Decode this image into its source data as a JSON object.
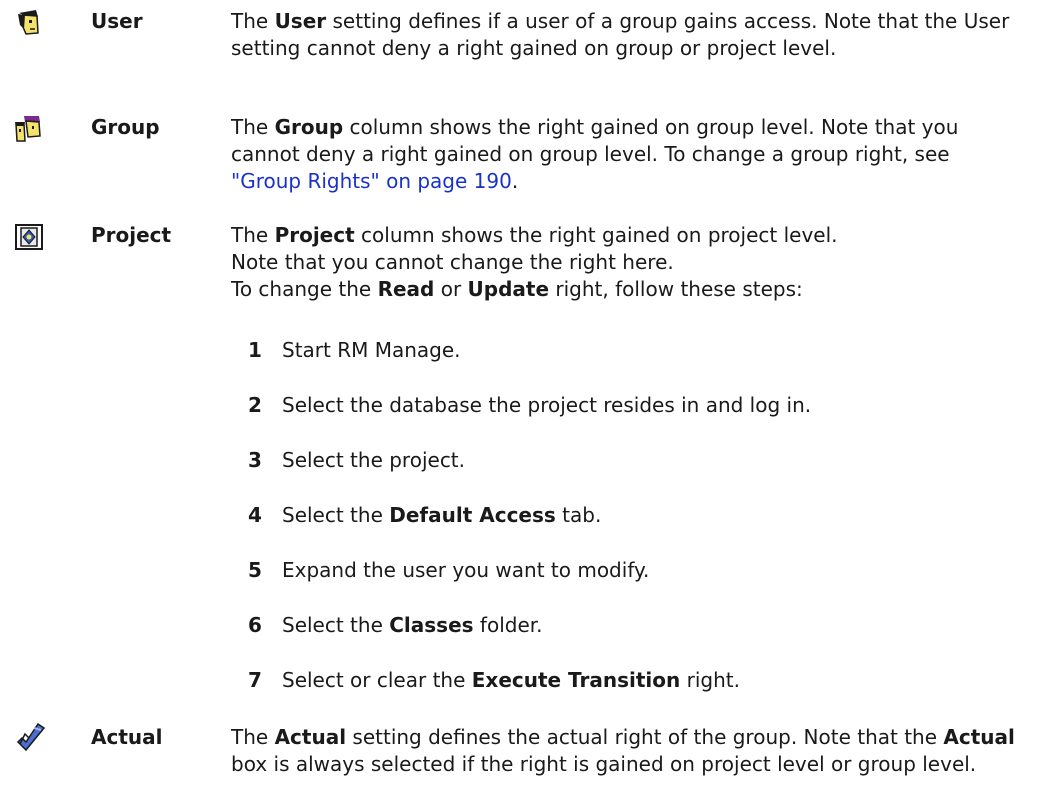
{
  "entries": [
    {
      "term": "User",
      "icon": "user-head-icon",
      "desc": {
        "pre": "The ",
        "bold": "User",
        "post": " setting defines if a user of a group gains access. Note that the User setting cannot deny a right gained on group or project level."
      }
    },
    {
      "term": "Group",
      "icon": "group-heads-icon",
      "desc": {
        "pre": "The ",
        "bold": "Group",
        "post": " column shows the right gained on group level. Note that you cannot deny a right gained on group level. To change a group right, see ",
        "link": "\"Group Rights\" on page 190",
        "end": "."
      }
    },
    {
      "term": "Project",
      "icon": "project-diamond-icon",
      "desc": {
        "pre": "The ",
        "bold": "Project",
        "post": " column shows the right gained on project level.",
        "line2": "Note that you cannot change the right here.",
        "line3_pre": "To change the ",
        "line3_b1": "Read",
        "line3_mid": " or ",
        "line3_b2": "Update",
        "line3_post": " right, follow these steps:"
      },
      "steps": [
        {
          "num": "1",
          "pre": "Start RM Manage.",
          "bold": "",
          "post": ""
        },
        {
          "num": "2",
          "pre": "Select the database the project resides in and log in.",
          "bold": "",
          "post": ""
        },
        {
          "num": "3",
          "pre": "Select the project.",
          "bold": "",
          "post": ""
        },
        {
          "num": "4",
          "pre": "Select the ",
          "bold": "Default Access",
          "post": " tab."
        },
        {
          "num": "5",
          "pre": "Expand the user you want to modify.",
          "bold": "",
          "post": ""
        },
        {
          "num": "6",
          "pre": "Select the ",
          "bold": "Classes",
          "post": " folder."
        },
        {
          "num": "7",
          "pre": "Select or clear the ",
          "bold": "Execute Transition",
          "post": " right."
        }
      ]
    },
    {
      "term": "Actual",
      "icon": "actual-checkmark-icon",
      "desc": {
        "pre": "The ",
        "bold": "Actual",
        "post": " setting defines the actual right of the group. Note that the ",
        "bold2": "Actual",
        "post2": " box is always selected if the right is gained on project level or group level."
      }
    }
  ]
}
